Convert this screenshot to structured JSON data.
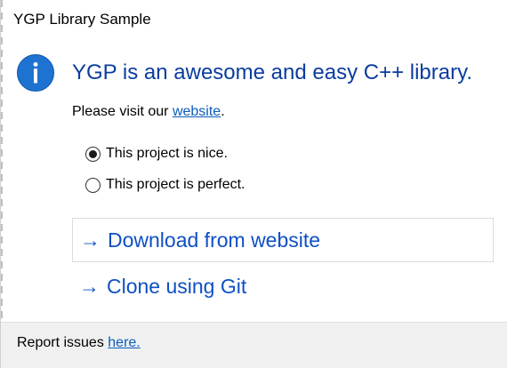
{
  "window": {
    "title": "YGP Library Sample"
  },
  "main_instruction": {
    "icon": "info-icon",
    "text": "YGP is an awesome and easy C++ library."
  },
  "content": {
    "prefix": "Please visit our ",
    "link_text": "website",
    "suffix": "."
  },
  "radios": [
    {
      "label": "This project is nice.",
      "checked": true
    },
    {
      "label": "This project is perfect.",
      "checked": false
    }
  ],
  "command_links": [
    {
      "arrow": "→",
      "label": "Download from website"
    },
    {
      "arrow": "→",
      "label": "Clone using Git"
    }
  ],
  "footer": {
    "prefix": "Report issues ",
    "link_text": "here."
  },
  "colors": {
    "instruction": "#0a3d9e",
    "link": "#0b5cbc",
    "command_link": "#0e50c4",
    "info_icon": "#1e73d2",
    "footer_bg": "#f0f0f0"
  }
}
